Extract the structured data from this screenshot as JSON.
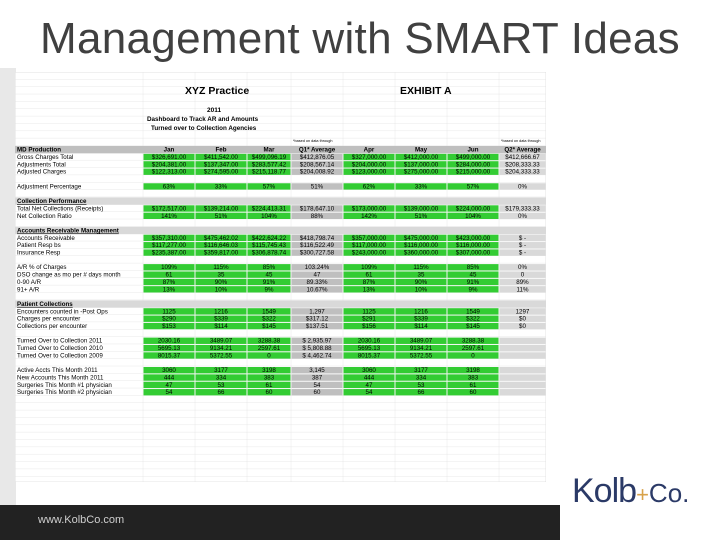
{
  "slide": {
    "title": "Management with SMART Ideas",
    "footer_url": "www.KolbCo.com",
    "logo": "Kolb + Co."
  },
  "sheet": {
    "practice": "XYZ Practice",
    "exhibit": "EXHIBIT A",
    "year": "2011",
    "subtitle1": "Dashboard to Track AR and Amounts",
    "subtitle2": "Turned over to Collection Agencies",
    "note_q1": "*based on data through",
    "note_q2": "*based on data through",
    "columns": [
      "MD Production",
      "Jan",
      "Feb",
      "Mar",
      "Q1* Average",
      "Apr",
      "May",
      "Jun",
      "Q2* Average"
    ],
    "sections": [
      {
        "kind": "rows",
        "rows": [
          {
            "label": "Gross Charges Total",
            "values": [
              "$326,691.00",
              "$411,542.00",
              "$499,096.19",
              "$412,876.05",
              "$327,000.00",
              "$412,000.00",
              "$499,000.00",
              "$412,666.67"
            ]
          },
          {
            "label": "Adjustments Total",
            "values": [
              "$204,381.00",
              "$137,347.00",
              "$283,577.42",
              "$208,567.14",
              "$204,000.00",
              "$137,000.00",
              "$284,000.00",
              "$208,333.33"
            ]
          },
          {
            "label": "Adjusted Charges",
            "values": [
              "$122,313.00",
              "$274,595.00",
              "$215,118.77",
              "$204,008.92",
              "$123,000.00",
              "$275,000.00",
              "$215,000.00",
              "$204,333.33"
            ]
          }
        ]
      },
      {
        "kind": "rows",
        "rows": [
          {
            "label": "Adjustment Percentage",
            "values": [
              "63%",
              "33%",
              "57%",
              "51%",
              "62%",
              "33%",
              "57%",
              "0%"
            ]
          }
        ]
      },
      {
        "kind": "header",
        "label": "Collection Performance"
      },
      {
        "kind": "rows",
        "rows": [
          {
            "label": "Total Net Collections (Receipts)",
            "values": [
              "$172,517.00",
              "$139,214.00",
              "$224,413.31",
              "$178,647.10",
              "$173,000.00",
              "$139,000.00",
              "$224,000.00",
              "$179,333.33"
            ]
          },
          {
            "label": "Net Collection Ratio",
            "values": [
              "141%",
              "51%",
              "104%",
              "88%",
              "142%",
              "51%",
              "104%",
              "0%"
            ]
          }
        ]
      },
      {
        "kind": "header",
        "label": "Accounts Receivable Management"
      },
      {
        "kind": "rows",
        "rows": [
          {
            "label": "Accounts Receivable",
            "values": [
              "$357,310.00",
              "$475,462.02",
              "$422,624.22",
              "$418,798.74",
              "$357,000.00",
              "$475,000.00",
              "$423,000.00",
              "$ -"
            ]
          },
          {
            "label": "Patient Resp bs",
            "values": [
              "$117,277.00",
              "$116,646.03",
              "$115,745.43",
              "$116,522.49",
              "$117,000.00",
              "$116,000.00",
              "$116,000.00",
              "$ -"
            ]
          },
          {
            "label": "Insurance Resp",
            "values": [
              "$235,387.00",
              "$359,817.00",
              "$306,878.74",
              "$300,727.58",
              "$243,000.00",
              "$360,000.00",
              "$307,000.00",
              "$ -"
            ]
          }
        ]
      },
      {
        "kind": "rows",
        "rows": [
          {
            "label": "A/R % of Charges",
            "values": [
              "109%",
              "115%",
              "85%",
              "103.24%",
              "109%",
              "115%",
              "85%",
              "0%"
            ]
          },
          {
            "label": "DSO change as mo per # days month",
            "values": [
              "61",
              "35",
              "45",
              "47",
              "61",
              "35",
              "45",
              "0"
            ]
          },
          {
            "label": "0-90 A/R",
            "values": [
              "87%",
              "90%",
              "91%",
              "89.33%",
              "87%",
              "90%",
              "91%",
              "89%"
            ]
          },
          {
            "label": "91+ A/R",
            "values": [
              "13%",
              "10%",
              "9%",
              "10.67%",
              "13%",
              "10%",
              "9%",
              "11%"
            ]
          }
        ]
      },
      {
        "kind": "header",
        "label": "Patient Collections"
      },
      {
        "kind": "rows",
        "rows": [
          {
            "label": "Encounters counted in -Post Ops",
            "values": [
              "1125",
              "1216",
              "1549",
              "1,297",
              "1125",
              "1216",
              "1549",
              "1297"
            ]
          },
          {
            "label": "Charges per encounter",
            "values": [
              "$290",
              "$339",
              "$322",
              "$317.12",
              "$291",
              "$339",
              "$322",
              "$0"
            ]
          },
          {
            "label": "Collections per encounter",
            "values": [
              "$153",
              "$114",
              "$145",
              "$137.51",
              "$156",
              "$114",
              "$145",
              "$0"
            ]
          }
        ]
      },
      {
        "kind": "rows",
        "rows": [
          {
            "label": "Turned Over to Collection 2011",
            "values": [
              "2030.16",
              "3489.07",
              "3288.38",
              "$ 2,935.97",
              "2030.16",
              "3489.07",
              "3288.38",
              ""
            ]
          },
          {
            "label": "Turned Over to Collection 2010",
            "values": [
              "5695.13",
              "9134.21",
              "2597.61",
              "$ 5,808.88",
              "5695.13",
              "9134.21",
              "2597.61",
              ""
            ]
          },
          {
            "label": "Turned Over to Collection 2009",
            "values": [
              "8015.37",
              "5372.55",
              "0",
              "$ 4,462.74",
              "8015.37",
              "5372.55",
              "0",
              ""
            ]
          }
        ]
      },
      {
        "kind": "rows",
        "rows": [
          {
            "label": "Active Accts This Month 2011",
            "values": [
              "3060",
              "3177",
              "3198",
              "3,145",
              "3060",
              "3177",
              "3198",
              ""
            ]
          },
          {
            "label": "New Accounts This Month 2011",
            "values": [
              "444",
              "334",
              "383",
              "387",
              "444",
              "334",
              "383",
              ""
            ]
          },
          {
            "label": "Surgeries This Month #1 physician",
            "values": [
              "47",
              "53",
              "61",
              "54",
              "47",
              "53",
              "61",
              ""
            ]
          },
          {
            "label": "Surgeries This Month #2 physician",
            "values": [
              "54",
              "66",
              "60",
              "60",
              "54",
              "66",
              "60",
              ""
            ]
          }
        ]
      }
    ]
  },
  "colors": {
    "header_bg": "#bfbfbf",
    "green_fill": "#33cc33",
    "grey_band": "#d9d9d9",
    "average_col": "#bfbfbf",
    "title": "#404040",
    "brand_navy": "#2b3a67",
    "brand_gold": "#d8a24a",
    "footer_bar": "#222222"
  }
}
